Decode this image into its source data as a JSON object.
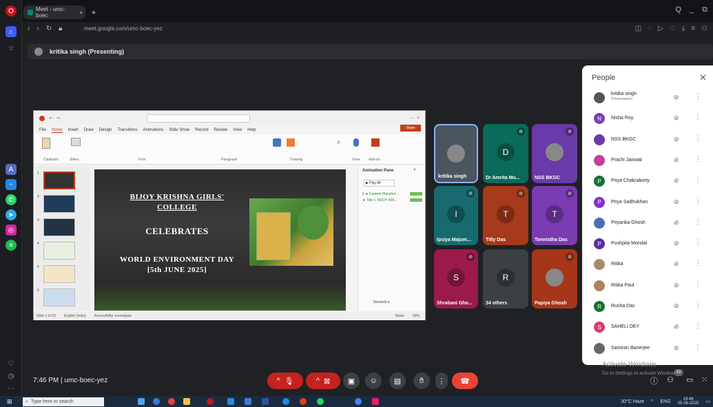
{
  "browser": {
    "tab_title": "Meet - umc-boec",
    "url": "meet.google.com/umc-boec-yez",
    "window_controls": [
      "Q",
      "_",
      "⧉"
    ]
  },
  "meet": {
    "presenting_label": "kritika singh (Presenting)",
    "time_code": "7:46 PM | umc-boec-yez",
    "watermark_title": "Activate Windows",
    "watermark_sub": "Go to Settings to activate Windows.",
    "participant_badge": "43"
  },
  "ppt": {
    "menu": [
      "File",
      "Home",
      "Insert",
      "Draw",
      "Design",
      "Transitions",
      "Animations",
      "Slide Show",
      "Record",
      "Review",
      "View",
      "Help"
    ],
    "ribbon_groups": [
      "Clipboard",
      "Slides",
      "Font",
      "Paragraph",
      "Drawing",
      "Voice",
      "Add-ins"
    ],
    "anim_title": "Animation Pane",
    "anim_play": "▶ Play All",
    "anim_items": [
      "0 ★ Content Placehol...",
      "★ Title 1: BIJOY KRI..."
    ],
    "status_left": "Slide 1 of 23",
    "status_lang": "English (India)",
    "status_access": "Accessibility: Investigate",
    "status_notes": "Notes",
    "status_zoom": "69%",
    "seconds_label": "Seconds ▾",
    "slide_numbers": [
      "1",
      "2",
      "3",
      "4",
      "5",
      "6"
    ],
    "slide": {
      "line1": "BIJOY KRISHNA GIRLS'",
      "line2": "COLLEGE",
      "line3": "CELEBRATES",
      "line4": "WORLD ENVIRONMENT DAY",
      "line5": "[5th JUNE 2025]"
    }
  },
  "tiles": [
    {
      "name": "kritika singh",
      "initial": "",
      "color": "#4a5560"
    },
    {
      "name": "Dr Amrita Mu...",
      "initial": "D",
      "color": "#0b6b5a"
    },
    {
      "name": "NSS BKGC",
      "initial": "",
      "color": "#6a3aa8"
    },
    {
      "name": "Ipsiya Majum...",
      "initial": "I",
      "color": "#176b6e"
    },
    {
      "name": "Titly Das",
      "initial": "T",
      "color": "#a63a1a"
    },
    {
      "name": "Tonnistha Das",
      "initial": "T",
      "color": "#7a3bb3"
    },
    {
      "name": "Shrabani Gho...",
      "initial": "S",
      "color": "#9b1a4b"
    },
    {
      "name": "34 others",
      "initial": "R",
      "color": "#3c4043"
    },
    {
      "name": "Papiya Ghosh",
      "initial": "",
      "color": "#a5361a"
    }
  ],
  "people": {
    "title": "People",
    "list": [
      {
        "name": "kritika singh",
        "sub": "Presentation",
        "initial": "",
        "color": "#555"
      },
      {
        "name": "Nisha Roy",
        "sub": "",
        "initial": "N",
        "color": "#7b3fb2"
      },
      {
        "name": "NSS BKGC",
        "sub": "",
        "initial": "",
        "color": "#6a3aa8"
      },
      {
        "name": "Prachi Jaiswal",
        "sub": "",
        "initial": "",
        "color": "#c43f9a"
      },
      {
        "name": "Priya Chakraborty",
        "sub": "",
        "initial": "P",
        "color": "#137333"
      },
      {
        "name": "Priya Sadhukhan",
        "sub": "",
        "initial": "P",
        "color": "#8430ce"
      },
      {
        "name": "Priyanka Ghosh",
        "sub": "",
        "initial": "",
        "color": "#4b6fb5"
      },
      {
        "name": "Pushpita Mondal",
        "sub": "",
        "initial": "P",
        "color": "#5b2ea6"
      },
      {
        "name": "Ritika",
        "sub": "",
        "initial": "",
        "color": "#a98a6a"
      },
      {
        "name": "Ritika Paul",
        "sub": "",
        "initial": "",
        "color": "#b08060"
      },
      {
        "name": "Rusha Das",
        "sub": "",
        "initial": "R",
        "color": "#137333"
      },
      {
        "name": "SAHELI DEY",
        "sub": "",
        "initial": "S",
        "color": "#d93a73"
      },
      {
        "name": "Samiran Banerjee",
        "sub": "",
        "initial": "",
        "color": "#666"
      }
    ]
  },
  "taskbar": {
    "search_placeholder": "Type here to search",
    "weather": "30°C Haze",
    "lang": "ENG",
    "time": "19:46",
    "date": "05-06-2025"
  }
}
